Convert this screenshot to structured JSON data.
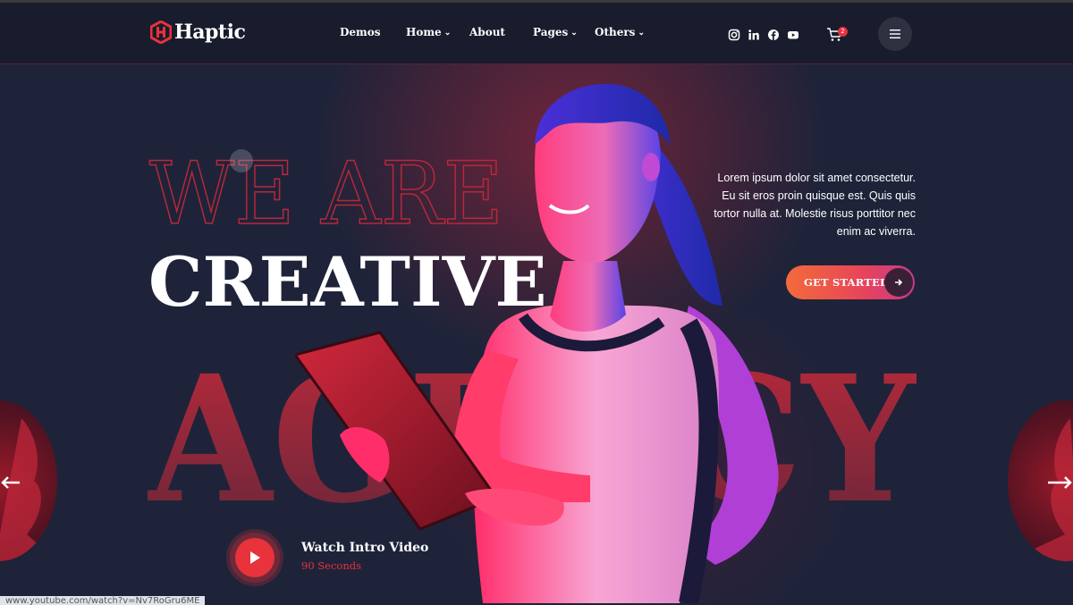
{
  "brand": {
    "name": "Haptic",
    "accent": "#e8323c"
  },
  "nav": {
    "items": [
      {
        "label": "Demos",
        "dropdown": false
      },
      {
        "label": "Home",
        "dropdown": true
      },
      {
        "label": "About",
        "dropdown": false
      },
      {
        "label": "Pages",
        "dropdown": true
      },
      {
        "label": "Others",
        "dropdown": true
      }
    ]
  },
  "social_icons": [
    "instagram-icon",
    "linkedin-icon",
    "facebook-icon",
    "youtube-icon"
  ],
  "cart": {
    "count": "2"
  },
  "hero": {
    "line1": "WE ARE",
    "line2": "CREATIVE",
    "line3": "AGENCY",
    "description": "Lorem ipsum dolor sit amet consectetur. Eu sit eros proin quisque est. Quis quis tortor nulla at. Molestie risus porttitor nec enim ac viverra.",
    "cta_label": "GET STARTED",
    "video_title": "Watch Intro Video",
    "video_subtitle": "90 Seconds"
  },
  "status_bar": {
    "url": "www.youtube.com/watch?v=Nv7RoGru6ME"
  }
}
